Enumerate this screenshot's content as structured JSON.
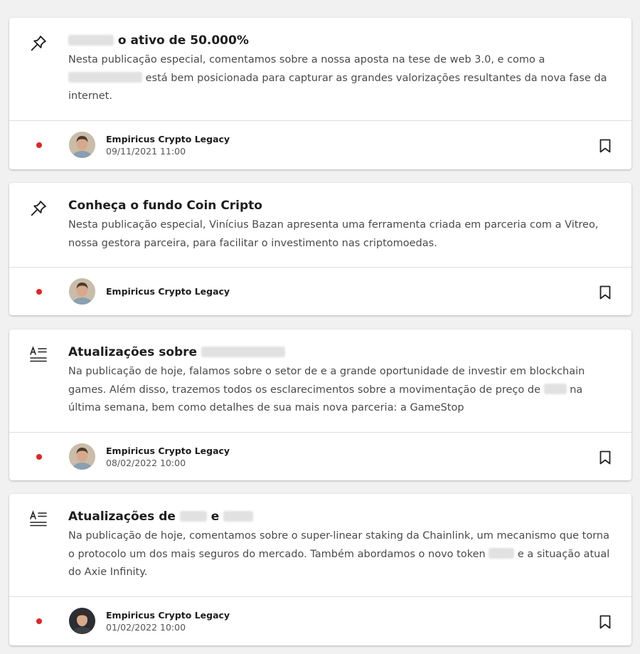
{
  "posts": [
    {
      "icon": "pin-icon",
      "title_after_blur": "o ativo de 50.000%",
      "desc_part1": "Nesta publicação especial, comentamos sobre a nossa aposta na tese de web 3.0, e como a",
      "desc_part2": "está bem posicionada para capturar as grandes valorizações resultantes da nova fase da internet.",
      "author": "Empiricus Crypto Legacy",
      "date": "09/11/2021 11:00"
    },
    {
      "icon": "pin-icon",
      "title": "Conheça o fundo Coin Cripto",
      "desc": "Nesta publicação especial, Vinícius Bazan apresenta uma ferramenta criada em parceria com a Vitreo, nossa gestora parceira, para facilitar o investimento nas criptomoedas.",
      "author": "Empiricus Crypto Legacy"
    },
    {
      "icon": "text-article-icon",
      "title": "Atualizações sobre",
      "desc_part1": "Na publicação de hoje, falamos sobre o setor de e a grande oportunidade de investir em blockchain games. Além disso, trazemos todos os esclarecimentos sobre a movimentação de preço de",
      "desc_part2": "na última semana, bem como detalhes de sua mais nova parceria: a GameStop",
      "author": "Empiricus Crypto Legacy",
      "date": "08/02/2022 10:00"
    },
    {
      "icon": "text-article-icon",
      "title_part1": "Atualizações de",
      "title_part2": "e",
      "desc_part1": "Na publicação de hoje, comentamos sobre o super-linear staking da Chainlink, um mecanismo que torna o protocolo um dos mais seguros do mercado. Também abordamos o novo token",
      "desc_part2": "e a situação atual do Axie Infinity.",
      "author": "Empiricus Crypto Legacy",
      "date": "01/02/2022 10:00"
    }
  ],
  "colors": {
    "unread_dot": "#e02424",
    "card_bg": "#ffffff",
    "page_bg": "#f1f1f1"
  }
}
